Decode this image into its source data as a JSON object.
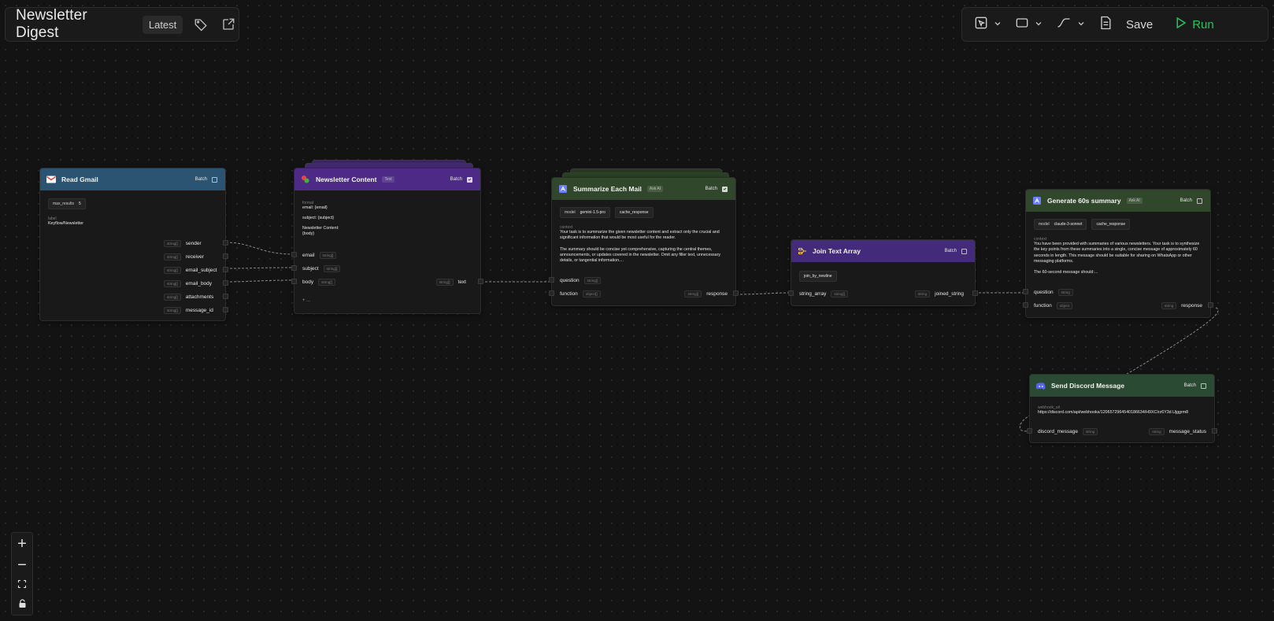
{
  "header": {
    "title": "Newsletter Digest",
    "version_badge": "Latest"
  },
  "toolbar": {
    "save_label": "Save",
    "run_label": "Run"
  },
  "zoom": {
    "zoom_in": "+",
    "zoom_out": "−"
  },
  "nodes": {
    "read_gmail": {
      "title": "Read Gmail",
      "batch_label": "Batch",
      "batch_checked": false,
      "max_results_label": "max_results",
      "max_results_value": "5",
      "label_label": "label",
      "label_value": "Keyflow/Newsletter",
      "outputs": [
        {
          "name": "sender",
          "type": "string[]"
        },
        {
          "name": "receiver",
          "type": "string[]"
        },
        {
          "name": "email_subject",
          "type": "string[]"
        },
        {
          "name": "email_body",
          "type": "string[]"
        },
        {
          "name": "attachments",
          "type": "string[]"
        },
        {
          "name": "message_id",
          "type": "string[]"
        }
      ],
      "color": "#2b5472"
    },
    "newsletter_content": {
      "title": "Newsletter Content",
      "tag": "Text",
      "batch_label": "Batch",
      "batch_checked": true,
      "format_label": "format",
      "format_lines": [
        "email: {email}",
        "subject: {subject}",
        "Newsletter Content:",
        "{body}"
      ],
      "inputs": [
        {
          "name": "email",
          "type": "string[]"
        },
        {
          "name": "subject",
          "type": "string[]"
        },
        {
          "name": "body",
          "type": "string[]"
        }
      ],
      "output": {
        "name": "text",
        "type": "string[]"
      },
      "add_label": "+ ...",
      "color": "#4c2a86"
    },
    "summarize_each_mail": {
      "title": "Summarize Each Mail",
      "tag": "Ask AI",
      "batch_label": "Batch",
      "batch_checked": true,
      "model_label": "model",
      "model_value": "gemini-1.5-pro",
      "cache_label": "cache_response",
      "context_label": "context",
      "context_text": "Your task is to summarize the given newsletter content and extract only the crucial and significant information that would be most useful for the reader.\n\nThe summary should be concise yet comprehensive, capturing the central themes, announcements, or updates covered in the newsletter. Omit any filler text, unnecessary details, or tangential information....",
      "inputs": [
        {
          "name": "question",
          "type": "string[]"
        },
        {
          "name": "function",
          "type": "object[]"
        }
      ],
      "output": {
        "name": "response",
        "type": "string[]"
      },
      "color": "#30472c"
    },
    "join_text_array": {
      "title": "Join Text Array",
      "batch_label": "Batch",
      "batch_checked": false,
      "option_label": "join_by_newline",
      "input": {
        "name": "string_array",
        "type": "string[]"
      },
      "output": {
        "name": "joined_string",
        "type": "string"
      },
      "color": "#432a7a"
    },
    "generate_summary": {
      "title": "Generate 60s summary",
      "tag": "Ask AI",
      "batch_label": "Batch",
      "batch_checked": false,
      "model_label": "model",
      "model_value": "claude-3-sonnet",
      "cache_label": "cache_response",
      "context_label": "context",
      "context_text": "You have been provided with summaries of various newsletters. Your task is to synthesize the key points from these summaries into a single, concise message of approximately 60 seconds in length. This message should be suitable for sharing on WhatsApp or other messaging platforms.\n\nThe 60-second message should:...",
      "inputs": [
        {
          "name": "question",
          "type": "string"
        },
        {
          "name": "function",
          "type": "object"
        }
      ],
      "output": {
        "name": "response",
        "type": "string"
      },
      "color": "#30472c"
    },
    "send_discord": {
      "title": "Send Discord Message",
      "batch_label": "Batch",
      "batch_checked": false,
      "webhook_label": "webhook_url",
      "webhook_value": "https://discord.com/api/webhooks/1206572964540186634/H9XCIrz6Y3d.Ujggrm8",
      "input": {
        "name": "discord_message",
        "type": "string"
      },
      "output": {
        "name": "message_status",
        "type": "string"
      },
      "color": "#2a4a33"
    }
  }
}
